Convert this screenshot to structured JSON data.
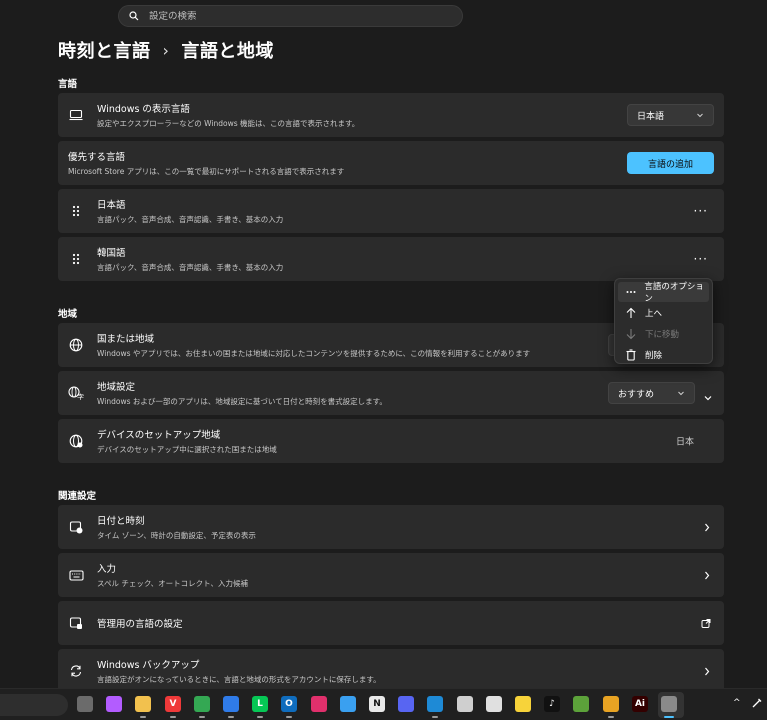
{
  "search": {
    "placeholder": "設定の検索"
  },
  "breadcrumb": {
    "parent": "時刻と言語",
    "separator": "›",
    "current": "言語と地域"
  },
  "language_section": {
    "title": "言語",
    "display_language": {
      "title": "Windows の表示言語",
      "subtitle": "設定やエクスプローラーなどの Windows 機能は、この言語で表示されます。",
      "value": "日本語"
    },
    "preferred": {
      "title": "優先する言語",
      "subtitle": "Microsoft Store アプリは、この一覧で最初にサポートされる言語で表示されます",
      "add_button": "言語の追加"
    },
    "languages": [
      {
        "name": "日本語",
        "features": "言語パック、音声合成、音声認識、手書き、基本の入力"
      },
      {
        "name": "韓国語",
        "features": "言語パック、音声合成、音声認識、手書き、基本の入力"
      }
    ],
    "more_glyph": "···"
  },
  "context_menu": {
    "items": [
      {
        "label": "言語のオプション",
        "icon": "more-icon",
        "disabled": false
      },
      {
        "label": "上へ",
        "icon": "arrow-up-icon",
        "disabled": false
      },
      {
        "label": "下に移動",
        "icon": "arrow-down-icon",
        "disabled": true
      },
      {
        "label": "削除",
        "icon": "trash-icon",
        "disabled": false
      }
    ]
  },
  "region_section": {
    "title": "地域",
    "country": {
      "title": "国または地域",
      "subtitle": "Windows やアプリでは、お住まいの国または地域に対応したコンテンツを提供するために、この情報を利用することがあります"
    },
    "format": {
      "title": "地域設定",
      "subtitle": "Windows および一部のアプリは、地域設定に基づいて日付と時刻を書式設定します。",
      "value": "おすすめ"
    },
    "setup_region": {
      "title": "デバイスのセットアップ地域",
      "subtitle": "デバイスのセットアップ中に選択された国または地域",
      "value": "日本"
    }
  },
  "related_section": {
    "title": "関連設定",
    "items": [
      {
        "title": "日付と時刻",
        "subtitle": "タイム ゾーン、時計の自動設定、予定表の表示"
      },
      {
        "title": "入力",
        "subtitle": "スペル チェック、オートコレクト、入力候補"
      },
      {
        "title": "管理用の言語の設定",
        "subtitle": ""
      },
      {
        "title": "Windows バックアップ",
        "subtitle": "言語設定がオンになっているときに、言語と地域の形式をアカウントに保存します。"
      }
    ]
  },
  "taskbar": {
    "apps": [
      {
        "name": "task-view-icon",
        "color": "#6b6b6b",
        "glyph": ""
      },
      {
        "name": "copilot-icon",
        "color": "#b35cff",
        "glyph": ""
      },
      {
        "name": "file-explorer-icon",
        "color": "#f2c14e",
        "glyph": ""
      },
      {
        "name": "vivaldi-icon",
        "color": "#ef3939",
        "glyph": "V"
      },
      {
        "name": "chrome-icon",
        "color": "#34a853",
        "glyph": ""
      },
      {
        "name": "microsoft-store-icon",
        "color": "#2f7be8",
        "glyph": ""
      },
      {
        "name": "line-icon",
        "color": "#06c755",
        "glyph": "L"
      },
      {
        "name": "outlook-icon",
        "color": "#0f6cbd",
        "glyph": "O"
      },
      {
        "name": "instagram-icon",
        "color": "#e1306c",
        "glyph": ""
      },
      {
        "name": "notes-icon",
        "color": "#3aa0f0",
        "glyph": ""
      },
      {
        "name": "notion-icon",
        "color": "#e8e8e8",
        "glyph": "N"
      },
      {
        "name": "discord-icon",
        "color": "#5865f2",
        "glyph": ""
      },
      {
        "name": "vscode-icon",
        "color": "#1e8ad6",
        "glyph": ""
      },
      {
        "name": "unity-icon",
        "color": "#cfcfcf",
        "glyph": ""
      },
      {
        "name": "unity-hub-icon",
        "color": "#e0e0e0",
        "glyph": ""
      },
      {
        "name": "sticky-notes-icon",
        "color": "#f7d33a",
        "glyph": ""
      },
      {
        "name": "tiktok-icon",
        "color": "#111111",
        "glyph": "♪"
      },
      {
        "name": "minecraft-icon",
        "color": "#5ca23a",
        "glyph": ""
      },
      {
        "name": "chrome-profile-icon",
        "color": "#e8a323",
        "glyph": ""
      },
      {
        "name": "illustrator-icon",
        "color": "#330000",
        "glyph": "Ai"
      },
      {
        "name": "settings-icon",
        "color": "#8a8a8a",
        "glyph": ""
      }
    ],
    "tray_chevron": "^"
  }
}
